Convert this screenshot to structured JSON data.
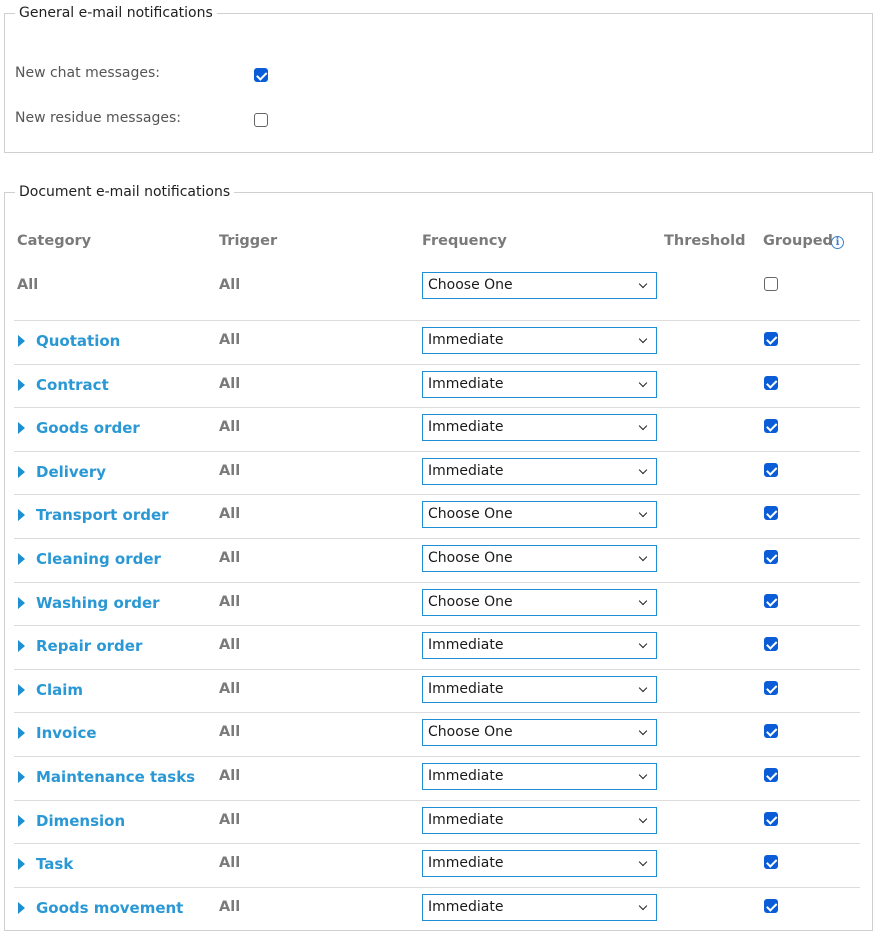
{
  "general": {
    "legend": "General e-mail notifications",
    "options": [
      {
        "label": "New chat messages:",
        "checked": true
      },
      {
        "label": "New residue messages:",
        "checked": false
      }
    ]
  },
  "documents": {
    "legend": "Document e-mail notifications",
    "headers": {
      "category": "Category",
      "trigger": "Trigger",
      "frequency": "Frequency",
      "threshold": "Threshold",
      "grouped": "Grouped"
    },
    "info_icon": "info-icon",
    "all_row": {
      "category": "All",
      "trigger": "All",
      "frequency": "Choose One",
      "grouped": false
    },
    "rows": [
      {
        "category": "Quotation",
        "trigger": "All",
        "frequency": "Immediate",
        "grouped": true
      },
      {
        "category": "Contract",
        "trigger": "All",
        "frequency": "Immediate",
        "grouped": true
      },
      {
        "category": "Goods order",
        "trigger": "All",
        "frequency": "Immediate",
        "grouped": true
      },
      {
        "category": "Delivery",
        "trigger": "All",
        "frequency": "Immediate",
        "grouped": true
      },
      {
        "category": "Transport order",
        "trigger": "All",
        "frequency": "Choose One",
        "grouped": true
      },
      {
        "category": "Cleaning order",
        "trigger": "All",
        "frequency": "Choose One",
        "grouped": true
      },
      {
        "category": "Washing order",
        "trigger": "All",
        "frequency": "Choose One",
        "grouped": true
      },
      {
        "category": "Repair order",
        "trigger": "All",
        "frequency": "Immediate",
        "grouped": true
      },
      {
        "category": "Claim",
        "trigger": "All",
        "frequency": "Immediate",
        "grouped": true
      },
      {
        "category": "Invoice",
        "trigger": "All",
        "frequency": "Choose One",
        "grouped": true
      },
      {
        "category": "Maintenance tasks",
        "trigger": "All",
        "frequency": "Immediate",
        "grouped": true
      },
      {
        "category": "Dimension",
        "trigger": "All",
        "frequency": "Immediate",
        "grouped": true
      },
      {
        "category": "Task",
        "trigger": "All",
        "frequency": "Immediate",
        "grouped": true
      },
      {
        "category": "Goods movement",
        "trigger": "All",
        "frequency": "Immediate",
        "grouped": true
      }
    ]
  },
  "colors": {
    "accent": "#2a98d4",
    "checkbox_checked": "#0b5cd7",
    "select_border": "#1e8fd2",
    "header_text": "#7a7a7a"
  }
}
